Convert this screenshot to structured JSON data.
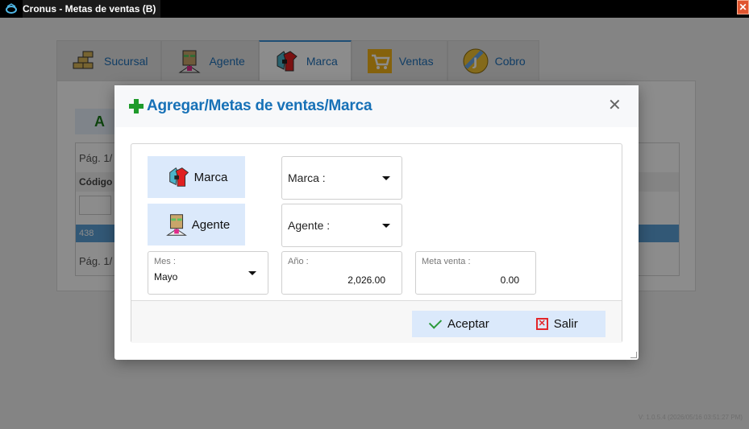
{
  "window": {
    "title": "Cronus - Metas de ventas (B)",
    "close_glyph": "✕"
  },
  "tabs": [
    {
      "label": "Sucursal",
      "icon": "bricks-icon"
    },
    {
      "label": "Agente",
      "icon": "agent-icon"
    },
    {
      "label": "Marca",
      "icon": "brand-icon"
    },
    {
      "label": "Ventas",
      "icon": "cart-icon"
    },
    {
      "label": "Cobro",
      "icon": "coin-icon"
    }
  ],
  "background": {
    "add_button_label": "A",
    "page_top": "Pág. 1/",
    "column_header": "Código",
    "row_value": "438",
    "page_bottom": "Pág. 1/",
    "version": "V: 1.0.5.4 (2026/05/16 03:51:27 PM)"
  },
  "dialog": {
    "title": "Agregar/Metas de ventas/Marca",
    "close_glyph": "✕",
    "marca_button": "Marca",
    "agente_button": "Agente",
    "marca_select": "Marca :",
    "agente_select": "Agente :",
    "mes": {
      "label": "Mes :",
      "value": "Mayo"
    },
    "anio": {
      "label": "Año :",
      "value": "2,026.00"
    },
    "meta": {
      "label": "Meta venta :",
      "value": "0.00"
    },
    "accept_label": "Aceptar",
    "exit_label": "Salir"
  },
  "colors": {
    "accent": "#1771b7",
    "button_bg": "#dbe9fb",
    "plus": "#1f9b2b",
    "exit": "#e3262a"
  }
}
